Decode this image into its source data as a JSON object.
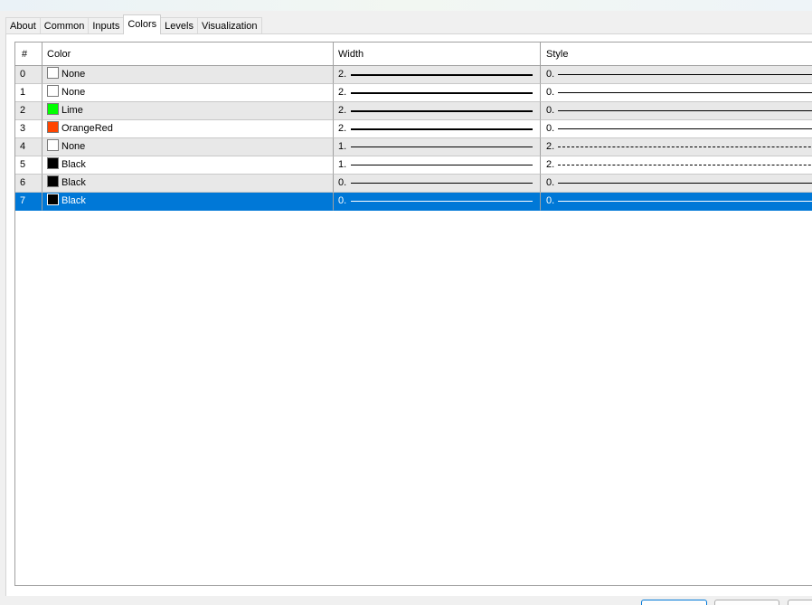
{
  "tabs": [
    {
      "label": "About"
    },
    {
      "label": "Common"
    },
    {
      "label": "Inputs"
    },
    {
      "label": "Colors",
      "active": true
    },
    {
      "label": "Levels"
    },
    {
      "label": "Visualization"
    }
  ],
  "table": {
    "headers": {
      "num": "#",
      "color": "Color",
      "width": "Width",
      "style": "Style"
    },
    "rows": [
      {
        "num": "0",
        "color": "None",
        "swatch": "#ffffff",
        "width_label": "2.",
        "width": 2,
        "style_label": "0.",
        "style": "solid"
      },
      {
        "num": "1",
        "color": "None",
        "swatch": "#ffffff",
        "width_label": "2.",
        "width": 2,
        "style_label": "0.",
        "style": "solid"
      },
      {
        "num": "2",
        "color": "Lime",
        "swatch": "#00ff00",
        "width_label": "2.",
        "width": 2,
        "style_label": "0.",
        "style": "solid"
      },
      {
        "num": "3",
        "color": "OrangeRed",
        "swatch": "#ff4500",
        "width_label": "2.",
        "width": 2,
        "style_label": "0.",
        "style": "solid"
      },
      {
        "num": "4",
        "color": "None",
        "swatch": "#ffffff",
        "width_label": "1.",
        "width": 1,
        "style_label": "2.",
        "style": "dashed"
      },
      {
        "num": "5",
        "color": "Black",
        "swatch": "#000000",
        "width_label": "1.",
        "width": 1,
        "style_label": "2.",
        "style": "dashed"
      },
      {
        "num": "6",
        "color": "Black",
        "swatch": "#000000",
        "width_label": "0.",
        "width": 1,
        "style_label": "0.",
        "style": "solid"
      },
      {
        "num": "7",
        "color": "Black",
        "swatch": "#000000",
        "width_label": "0.",
        "width": 1,
        "style_label": "0.",
        "style": "solid",
        "selected": true
      }
    ]
  },
  "colors": {
    "selection": "#0078d7",
    "row_shade": "#e8e8e8"
  }
}
